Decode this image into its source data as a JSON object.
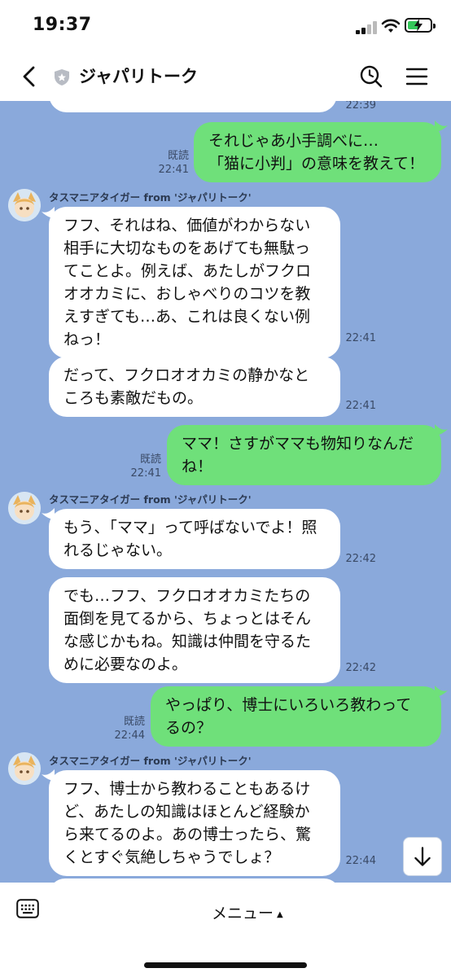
{
  "status_bar": {
    "time": "19:37"
  },
  "header": {
    "title": "ジャパリトーク"
  },
  "messages": [
    {
      "text": "",
      "time": "22:39"
    },
    {
      "text": "それじゃあ小手調べに…\n「猫に小判」の意味を教えて！",
      "read": "既読",
      "time": "22:41"
    },
    {
      "sender": "タスマニアタイガー from 'ジャパリトーク'",
      "text": "フフ、それはね、価値がわからない\n相手に大切なものをあげても無駄っ\nてことよ。例えば、あたしがフクロ\nオオカミに、おしゃべりのコツを教\nえすぎても…あ、これは良くない例\nねっ！",
      "time": "22:41"
    },
    {
      "text": "だって、フクロオオカミの静かなと\nころも素敵だもの。",
      "time": "22:41"
    },
    {
      "text": "ママ！さすがママも物知りなんだ\nね！",
      "read": "既読",
      "time": "22:41"
    },
    {
      "sender": "タスマニアタイガー from 'ジャパリトーク'",
      "text": "もう、「ママ」って呼ばないでよ！照\nれるじゃない。",
      "time": "22:42"
    },
    {
      "text": "でも…フフ、フクロオオカミたちの\n面倒を見てるから、ちょっとはそん\nな感じかもね。知識は仲間を守るた\nめに必要なのよ。",
      "time": "22:42"
    },
    {
      "text": "やっぱり、博士にいろいろ教わって\nるの？",
      "read": "既読",
      "time": "22:44"
    },
    {
      "sender": "タスマニアタイガー from 'ジャパリトーク'",
      "text": "フフ、博士から教わることもあるけ\nど、あたしの知識はほとんど経験か\nら来てるのよ。あの博士ったら、驚\nくとすぐ気絶しちゃうでしょ？",
      "time": "22:44"
    }
  ],
  "bottom_bar": {
    "menu_label": "メニュー"
  },
  "colors": {
    "chat_bg": "#8aa9db",
    "outgoing_bubble": "#6fe07a",
    "incoming_bubble": "#ffffff"
  }
}
